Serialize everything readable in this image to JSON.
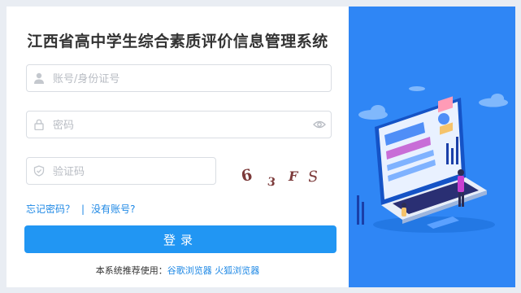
{
  "title": "江西省高中学生综合素质评价信息管理系统",
  "form": {
    "account_placeholder": "账号/身份证号",
    "password_placeholder": "密码",
    "captcha_placeholder": "验证码",
    "captcha_chars": [
      "6",
      "3",
      "F",
      "S"
    ]
  },
  "links": {
    "forgot_password": "忘记密码？",
    "separator": "|",
    "no_account": "没有账号?"
  },
  "login_button": "登录",
  "recommend": {
    "prefix": "本系统推荐使用：",
    "chrome": "谷歌浏览器",
    "firefox": "火狐浏览器"
  },
  "colors": {
    "primary": "#2196f3",
    "panel": "#2f86f5",
    "link": "#1e88e5"
  }
}
